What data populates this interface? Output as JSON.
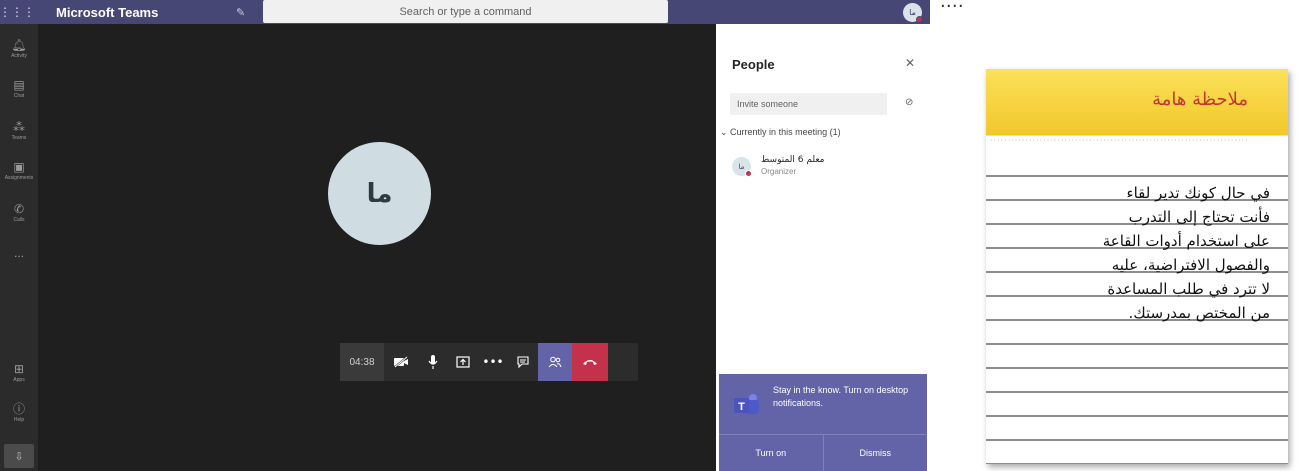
{
  "topbar": {
    "app_title": "Microsoft Teams",
    "search_placeholder": "Search or type a command",
    "avatar_initials": "ما"
  },
  "rail": {
    "items": [
      {
        "label": "Activity",
        "icon": "bell-icon"
      },
      {
        "label": "Chat",
        "icon": "chat-icon"
      },
      {
        "label": "Teams",
        "icon": "teams-icon"
      },
      {
        "label": "Assignments",
        "icon": "assignments-icon"
      },
      {
        "label": "Calls",
        "icon": "phone-icon"
      },
      {
        "label": "...",
        "icon": "more-icon"
      }
    ],
    "bottom_items": [
      {
        "label": "Apps",
        "icon": "apps-icon"
      },
      {
        "label": "Help",
        "icon": "help-icon"
      }
    ]
  },
  "meeting": {
    "avatar_initials": "ما",
    "timer": "04:38"
  },
  "people_pane": {
    "title": "People",
    "invite_placeholder": "Invite someone",
    "section_label": "Currently in this meeting (1)",
    "person": {
      "initials": "ما",
      "name": "معلم 6 المتوسط",
      "role": "Organizer"
    }
  },
  "toast": {
    "message": "Stay in the know. Turn on desktop notifications.",
    "turn_on": "Turn on",
    "dismiss": "Dismiss"
  },
  "note": {
    "title": "ملاحظة هامة",
    "lines": [
      "في حال كونك تدير لقاء",
      "فأنت تحتاج إلى التدرب",
      "على استخدام أدوات القاعة",
      "والفصول الافتراضية، عليه",
      "لا تترد في طلب المساعدة",
      "من المختص بمدرستك."
    ]
  },
  "colors": {
    "teams_purple": "#464775",
    "accent": "#6264a7",
    "hangup_red": "#c4314b",
    "note_yellow": "#f2c72a",
    "note_title_red": "#c0392b"
  }
}
